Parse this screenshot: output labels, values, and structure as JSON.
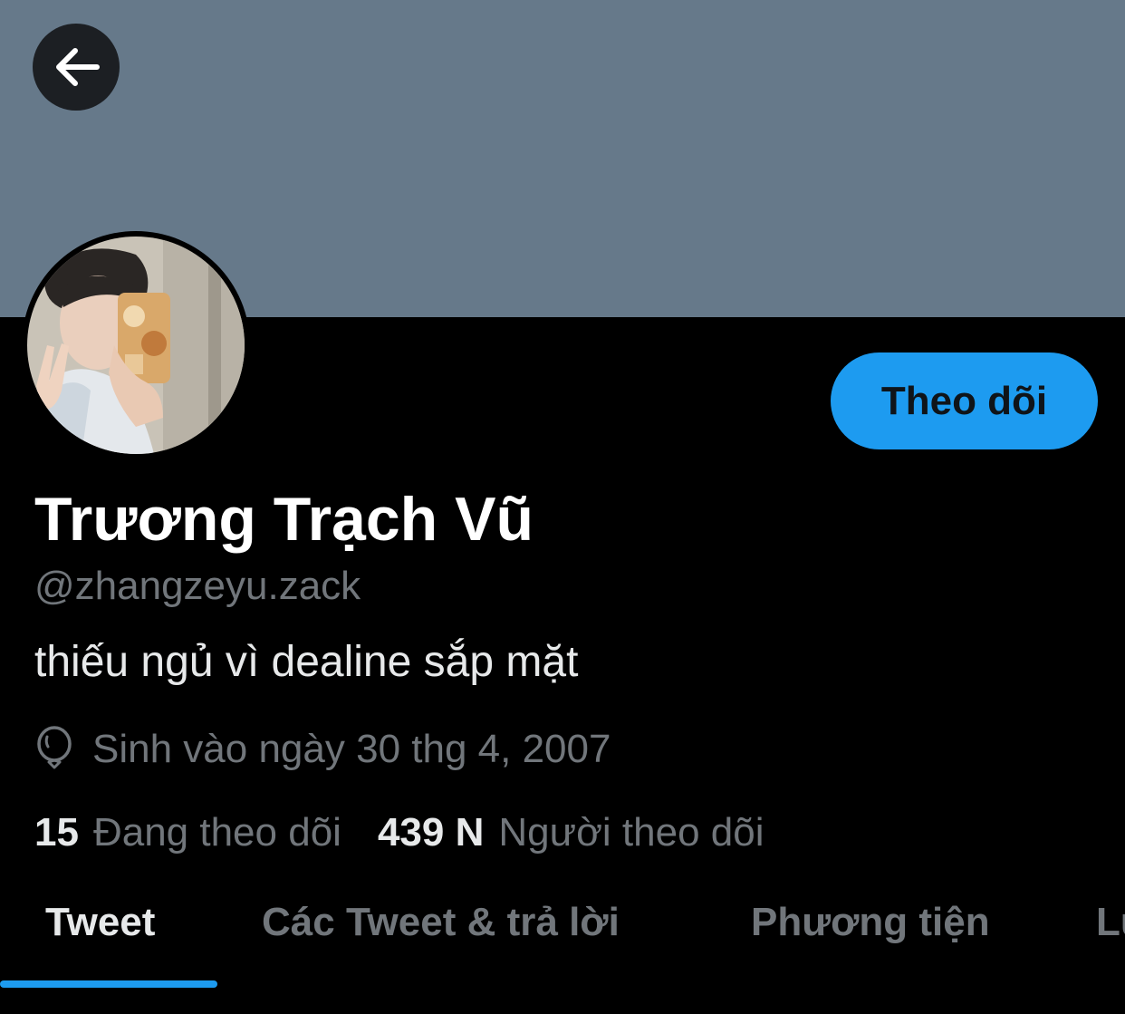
{
  "header": {
    "back_icon": "arrow-left-icon",
    "banner_color": "#66798a"
  },
  "profile": {
    "display_name": "Trương Trạch Vũ",
    "handle": "@zhangzeyu.zack",
    "bio": "thiếu ngủ vì dealine sắp mặt",
    "birth_icon": "balloon-icon",
    "birth_text": "Sinh vào ngày 30 thg 4, 2007",
    "follow_label": "Theo dõi"
  },
  "stats": {
    "following_count": "15",
    "following_label": "Đang theo dõi",
    "followers_count": "439 N",
    "followers_label": "Người theo dõi"
  },
  "tabs": [
    {
      "label": "Tweet",
      "active": true
    },
    {
      "label": "Các Tweet & trả lời",
      "active": false
    },
    {
      "label": "Phương tiện",
      "active": false
    },
    {
      "label": "Lư",
      "active": false
    }
  ],
  "colors": {
    "accent": "#1d9bf0",
    "secondary_text": "#71767b",
    "primary_text": "#e7e9ea",
    "background": "#000000"
  }
}
